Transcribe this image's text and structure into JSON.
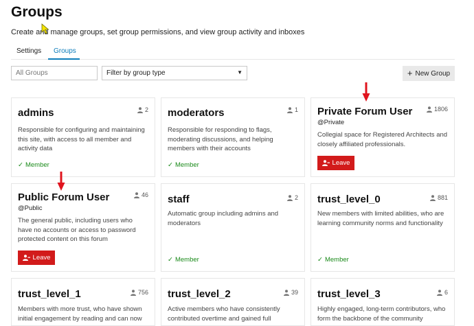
{
  "page": {
    "title": "Groups",
    "description": "Create and manage groups, set group permissions, and view group activity and inboxes"
  },
  "tabs": [
    {
      "label": "Settings",
      "active": false
    },
    {
      "label": "Groups",
      "active": true
    }
  ],
  "toolbar": {
    "search_placeholder": "All Groups",
    "filter_label": "Filter by group type",
    "new_group_label": "New Group"
  },
  "colors": {
    "accent": "#0c7cba",
    "member_green": "#1a8a1a",
    "leave_red": "#d21b1b",
    "annotation_arrow": "#e0141e"
  },
  "cards": [
    {
      "name": "admins",
      "handle": "",
      "count": "2",
      "description": "Responsible for configuring and maintaining this site, with access to all member and activity data",
      "status": "Member"
    },
    {
      "name": "moderators",
      "handle": "",
      "count": "1",
      "description": "Responsible for responding to flags, moderating discussions, and helping members with their accounts",
      "status": "Member"
    },
    {
      "name": "Private Forum User",
      "handle": "@Private",
      "count": "1806",
      "description": "Collegial space for Registered Architects and closely affiliated professionals.",
      "action": "Leave"
    },
    {
      "name": "Public Forum User",
      "handle": "@Public",
      "count": "46",
      "description": "The general public, including users who have no accounts or access to password protected content on this forum",
      "action": "Leave"
    },
    {
      "name": "staff",
      "handle": "",
      "count": "2",
      "description": "Automatic group including admins and moderators",
      "status": "Member"
    },
    {
      "name": "trust_level_0",
      "handle": "",
      "count": "881",
      "description": "New members with limited abilities, who are learning community norms and functionality",
      "status": "Member"
    },
    {
      "name": "trust_level_1",
      "handle": "",
      "count": "756",
      "description": "Members with more trust, who have shown initial engagement by reading and can now"
    },
    {
      "name": "trust_level_2",
      "handle": "",
      "count": "39",
      "description": "Active members who have consistently contributed overtime and gained full"
    },
    {
      "name": "trust_level_3",
      "handle": "",
      "count": "6",
      "description": "Highly engaged, long-term contributors, who form the backbone of the community"
    }
  ]
}
